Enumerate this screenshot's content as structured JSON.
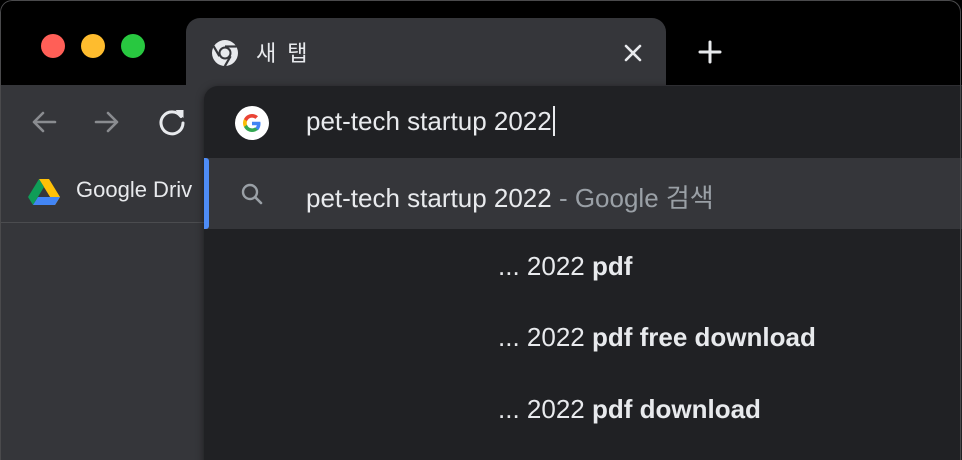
{
  "tab": {
    "title": "새 탭",
    "favicon": "chrome-icon"
  },
  "new_tab": {
    "icon": "plus-icon"
  },
  "toolbar": {
    "back_icon": "arrow-left-icon",
    "forward_icon": "arrow-right-icon",
    "reload_icon": "reload-icon"
  },
  "bookmarks": [
    {
      "label": "Google Driv",
      "icon": "google-drive-icon"
    }
  ],
  "omnibox": {
    "value": "pet-tech startup 2022",
    "engine_icon": "google-g-icon"
  },
  "suggestions": {
    "selected": {
      "query": "pet-tech startup 2022",
      "separator": " - ",
      "source": "Google 검색",
      "icon": "search-icon"
    },
    "items": [
      {
        "prefix": "... 2022 ",
        "bold": "pdf"
      },
      {
        "prefix": "... 2022 ",
        "bold": "pdf free download"
      },
      {
        "prefix": "... 2022 ",
        "bold": "pdf download"
      }
    ]
  },
  "colors": {
    "frame": "#000000",
    "toolbar": "#35363a",
    "dropdown": "#202124",
    "selection_bar": "#4e8cf6",
    "text": "#e8eaed",
    "muted": "#9aa0a6"
  }
}
